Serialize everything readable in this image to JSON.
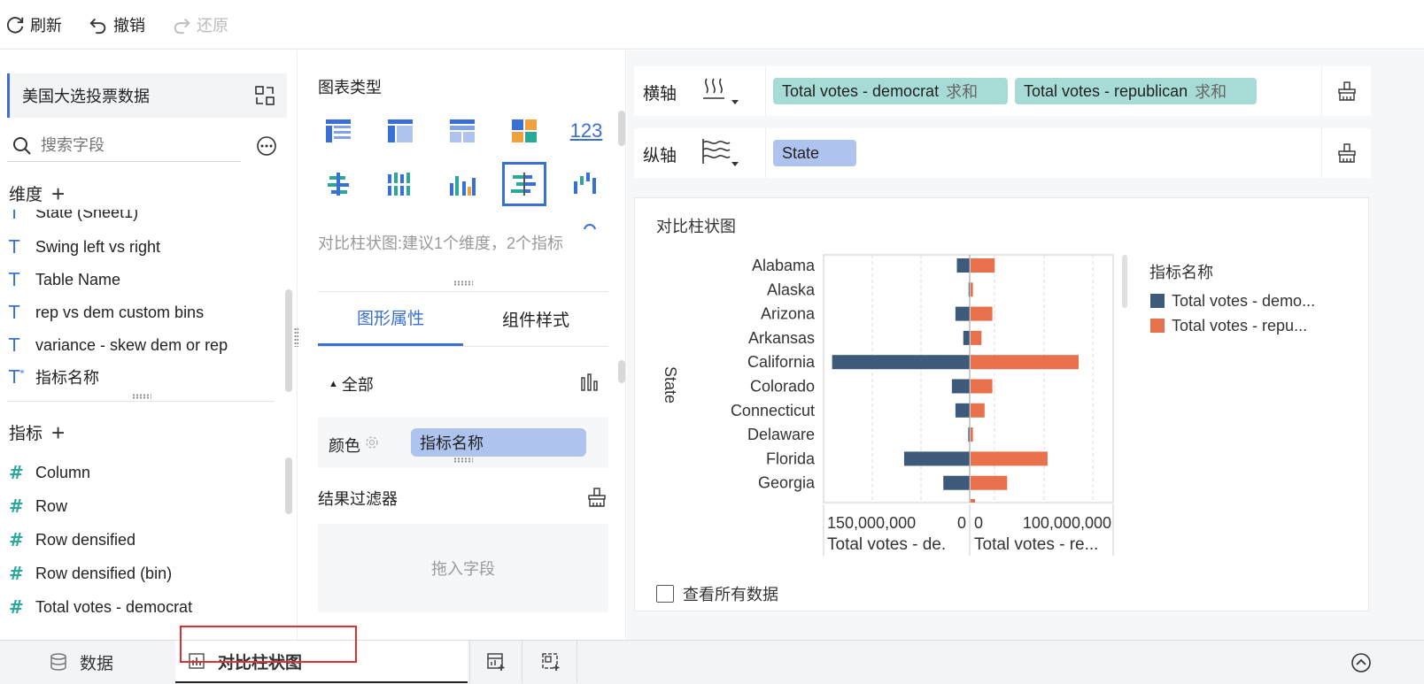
{
  "toolbar": {
    "refresh": "刷新",
    "undo": "撤销",
    "redo": "还原"
  },
  "left": {
    "dataset_name": "美国大选投票数据",
    "search_placeholder": "搜索字段",
    "dimensions_title": "维度",
    "dimensions": [
      {
        "label": "State (Sheet1)",
        "icon": "text-icon"
      },
      {
        "label": "Swing left vs right",
        "icon": "text-icon"
      },
      {
        "label": "Table Name",
        "icon": "text-icon"
      },
      {
        "label": "rep vs dem custom bins",
        "icon": "text-icon"
      },
      {
        "label": "variance - skew dem or rep",
        "icon": "text-icon"
      },
      {
        "label": "指标名称",
        "icon": "text-star-icon"
      }
    ],
    "measures_title": "指标",
    "measures": [
      {
        "label": "Column",
        "icon": "hash-icon"
      },
      {
        "label": "Row",
        "icon": "hash-icon"
      },
      {
        "label": "Row densified",
        "icon": "hash-icon"
      },
      {
        "label": "Row densified (bin)",
        "icon": "hash-icon"
      },
      {
        "label": "Total votes - democrat",
        "icon": "hash-icon"
      }
    ]
  },
  "mid": {
    "chart_type_title": "图表类型",
    "chart_hint": "对比柱状图:建议1个维度，2个指标",
    "tabs": [
      "图形属性",
      "组件样式"
    ],
    "all_label": "全部",
    "color_label": "颜色",
    "color_field": "指标名称",
    "result_filter": "结果过滤器",
    "drop_hint": "拖入字段",
    "kpi_icon_text": "123"
  },
  "axes": {
    "x_label": "横轴",
    "y_label": "纵轴",
    "x_fields": [
      {
        "name": "Total votes - democrat",
        "agg": "求和"
      },
      {
        "name": "Total votes - republican",
        "agg": "求和"
      }
    ],
    "y_fields": [
      {
        "name": "State"
      }
    ]
  },
  "chart_data": {
    "type": "bar",
    "title": "对比柱状图",
    "ylabel": "State",
    "categories": [
      "Alabama",
      "Alaska",
      "Arizona",
      "Arkansas",
      "California",
      "Colorado",
      "Connecticut",
      "Delaware",
      "Florida",
      "Georgia"
    ],
    "series": [
      {
        "name": "Total votes - democrat",
        "color": "#3d5a7a",
        "values": [
          18000000,
          1500000,
          20000000,
          9000000,
          193000000,
          25000000,
          20000000,
          2000000,
          92000000,
          37000000
        ]
      },
      {
        "name": "Total votes - republican",
        "color": "#e8704a",
        "values": [
          31000000,
          3000000,
          28000000,
          14000000,
          139000000,
          28000000,
          18000000,
          3000000,
          99000000,
          47000000
        ]
      }
    ],
    "left_axis": {
      "tick_labels": [
        "150,000,000",
        "0"
      ],
      "label": "Total votes - de.",
      "max": 200000000
    },
    "right_axis": {
      "tick_labels": [
        "0",
        "100,000,000"
      ],
      "label": "Total votes - re...",
      "max": 180000000
    },
    "legend": {
      "title": "指标名称",
      "items": [
        "Total votes - demo...",
        "Total votes - repu..."
      ],
      "position": "right"
    },
    "grid": true
  },
  "view_all": "查看所有数据",
  "bottom": {
    "data_tab": "数据",
    "chart_tab": "对比柱状图"
  }
}
